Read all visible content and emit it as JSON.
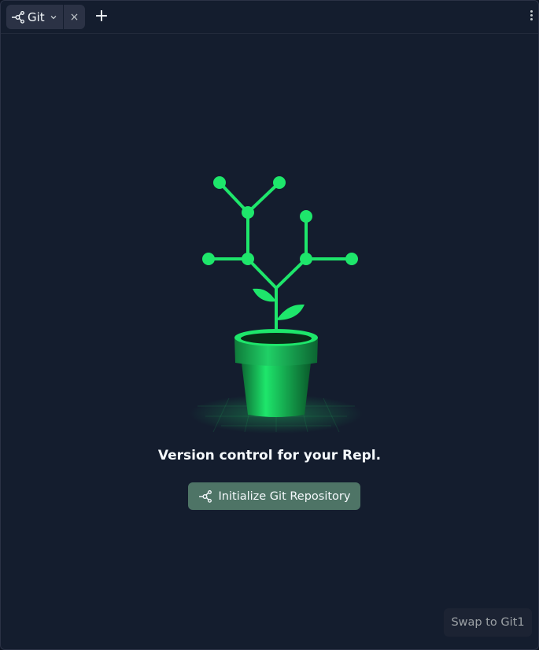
{
  "tab": {
    "label": "Git",
    "icon": "git-branch-icon",
    "close_glyph": "×"
  },
  "toolbar": {
    "add_glyph": "+"
  },
  "main": {
    "tagline": "Version control for your Repl.",
    "init_button_label": "Initialize Git Repository"
  },
  "footer": {
    "swap_label": "Swap to Git1"
  },
  "colors": {
    "background": "#141d2e",
    "accent_green": "#1ee66b",
    "button_green": "#4e7466"
  }
}
